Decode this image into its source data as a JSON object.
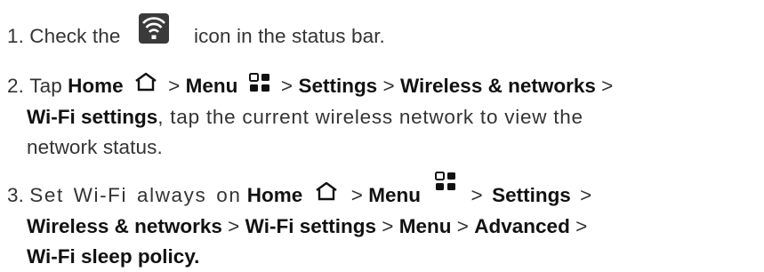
{
  "steps": [
    {
      "number": "1.",
      "parts": [
        "Check the",
        "icon in the status bar."
      ]
    },
    {
      "number": "2.",
      "line1": [
        "Tap",
        "Home",
        ">",
        "Menu",
        ">",
        "Settings",
        ">",
        "Wireless & networks",
        ">"
      ],
      "line2": [
        "Wi-Fi settings",
        ", tap the current wireless network to view the"
      ],
      "line3": "network status."
    },
    {
      "number": "3.",
      "line1": [
        "Set Wi-Fi always on",
        "Home",
        ">",
        "Menu",
        ">",
        "Settings",
        ">"
      ],
      "line2": [
        "Wireless & networks",
        ">",
        "Wi-Fi settings",
        ">",
        "Menu",
        ">",
        "Advanced",
        ">"
      ],
      "line3": "Wi-Fi sleep policy."
    }
  ],
  "icons": {
    "wifi": "wifi-status-icon",
    "home": "home-icon",
    "menu": "menu-grid-icon"
  }
}
